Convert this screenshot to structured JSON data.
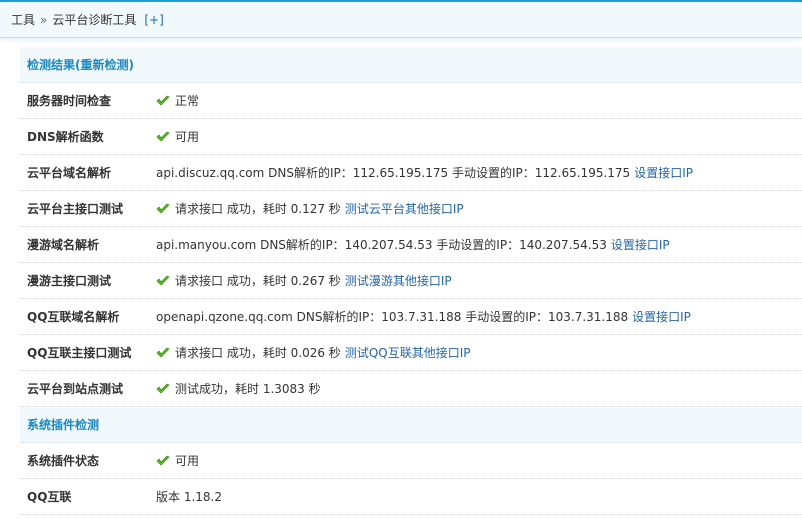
{
  "breadcrumb": {
    "root": "工具",
    "sep": "»",
    "current": "云平台诊断工具",
    "add": "[+]"
  },
  "sections": [
    {
      "title": "检测结果(重新检测)",
      "rows": [
        {
          "label": "服务器时间检查",
          "ok": true,
          "text": "正常",
          "link": ""
        },
        {
          "label": "DNS解析函数",
          "ok": true,
          "text": "可用",
          "link": ""
        },
        {
          "label": "云平台域名解析",
          "ok": false,
          "text": "api.discuz.qq.com DNS解析的IP：112.65.195.175 手动设置的IP：112.65.195.175",
          "link": "设置接口IP"
        },
        {
          "label": "云平台主接口测试",
          "ok": true,
          "text": "请求接口 成功，耗时 0.127 秒",
          "link": "测试云平台其他接口IP"
        },
        {
          "label": "漫游域名解析",
          "ok": false,
          "text": "api.manyou.com DNS解析的IP：140.207.54.53 手动设置的IP：140.207.54.53",
          "link": "设置接口IP"
        },
        {
          "label": "漫游主接口测试",
          "ok": true,
          "text": "请求接口 成功，耗时 0.267 秒",
          "link": "测试漫游其他接口IP"
        },
        {
          "label": "QQ互联域名解析",
          "ok": false,
          "text": "openapi.qzone.qq.com DNS解析的IP：103.7.31.188 手动设置的IP：103.7.31.188",
          "link": "设置接口IP"
        },
        {
          "label": "QQ互联主接口测试",
          "ok": true,
          "text": "请求接口 成功，耗时 0.026 秒",
          "link": "测试QQ互联其他接口IP"
        },
        {
          "label": "云平台到站点测试",
          "ok": true,
          "text": "测试成功，耗时 1.3083 秒",
          "link": ""
        }
      ]
    },
    {
      "title": "系统插件检测",
      "rows": [
        {
          "label": "系统插件状态",
          "ok": true,
          "text": "可用",
          "link": ""
        },
        {
          "label": "QQ互联",
          "ok": false,
          "text": "版本 1.18.2",
          "link": ""
        }
      ]
    }
  ]
}
